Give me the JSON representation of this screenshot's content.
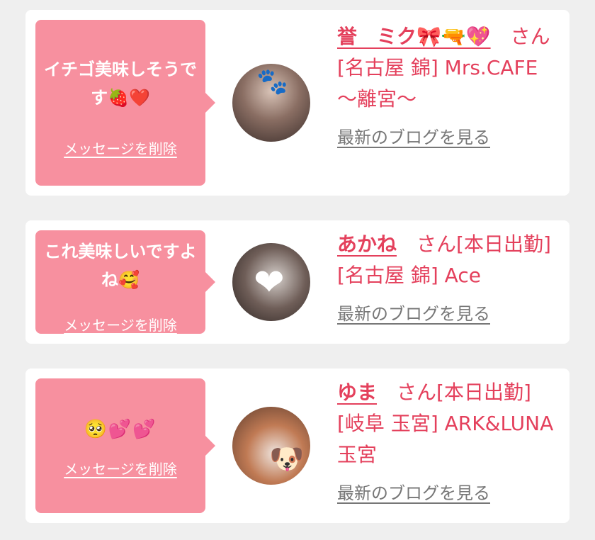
{
  "messages": [
    {
      "message": "イチゴ美味しそうです🍓❤️",
      "delete_label": "メッセージを削除",
      "girl_name": "誉　ミク🎀🔫💖",
      "honorific": "　さん",
      "status": "",
      "area": "[名古屋 錦]",
      "shop": "Mrs.CAFE～離宮～",
      "blog_label": "最新のブログを見る",
      "avatar_sticker": "🐾"
    },
    {
      "message": "これ美味しいですよね🥰",
      "delete_label": "メッセージを削除",
      "girl_name": "あかね",
      "honorific": "　さん",
      "status": "[本日出勤]",
      "area": "[名古屋 錦]",
      "shop": "Ace",
      "blog_label": "最新のブログを見る",
      "avatar_sticker": "❤"
    },
    {
      "message": "🥺💕💕",
      "delete_label": "メッセージを削除",
      "girl_name": "ゆま",
      "honorific": "　さん",
      "status": "[本日出勤]",
      "area": "[岐阜 玉宮]",
      "shop": "ARK&LUNA 玉宮",
      "blog_label": "最新のブログを見る",
      "avatar_sticker": "🐶"
    }
  ]
}
